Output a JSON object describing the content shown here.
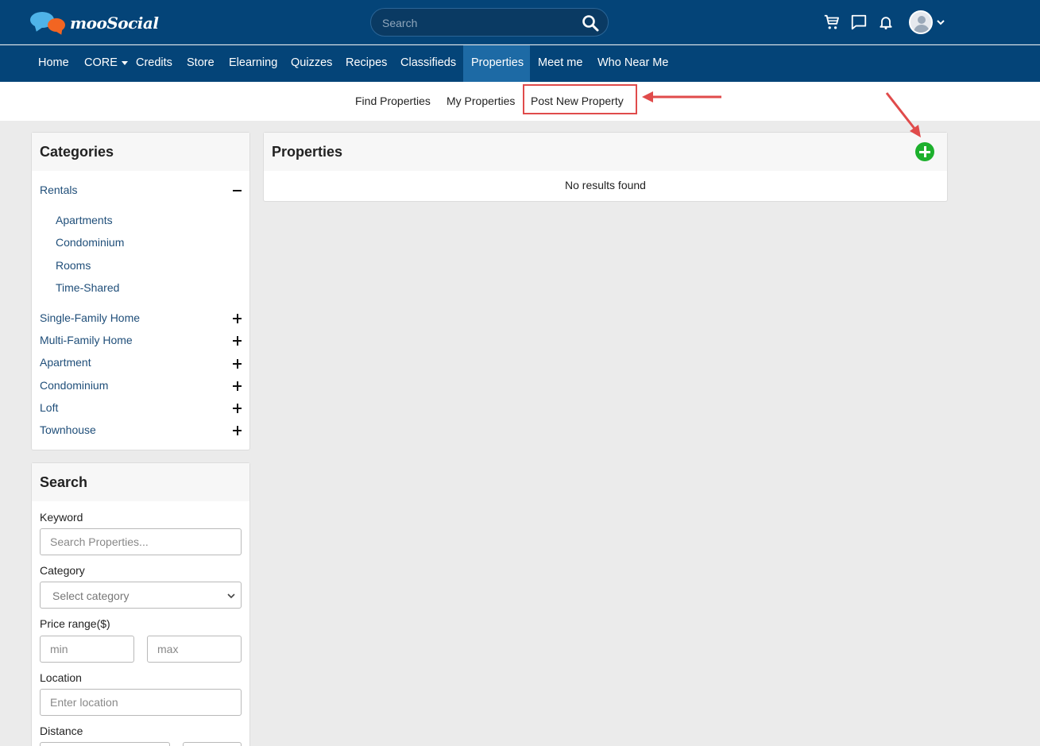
{
  "header": {
    "logo_text": "mooSocial",
    "search_placeholder": "Search"
  },
  "icons": [
    "cart-icon",
    "chat-icon",
    "bell-icon",
    "avatar",
    "chevron-down-icon",
    "search-icon",
    "add-icon"
  ],
  "colors": {
    "header_bg": "#044478",
    "active_nav": "#1d6aa5",
    "link": "#1f4e79",
    "add_button": "#1db02d",
    "annotation": "#e04b4b"
  },
  "nav": {
    "items": [
      "Home",
      "CORE",
      "Credits",
      "Store",
      "Elearning",
      "Quizzes",
      "Recipes",
      "Classifieds",
      "Properties",
      "Meet me",
      "Who Near Me"
    ],
    "active": "Properties"
  },
  "subnav": {
    "find": "Find Properties",
    "mine": "My Properties",
    "post": "Post New Property"
  },
  "categories": {
    "title": "Categories",
    "rentals": "Rentals",
    "rental_subs": [
      "Apartments",
      "Condominium",
      "Rooms",
      "Time-Shared"
    ],
    "others": [
      "Single-Family Home",
      "Multi-Family Home",
      "Apartment",
      "Condominium",
      "Loft",
      "Townhouse"
    ]
  },
  "search": {
    "title": "Search",
    "keyword_label": "Keyword",
    "keyword_placeholder": "Search Properties...",
    "category_label": "Category",
    "category_placeholder": "Select category",
    "price_label": "Price range($)",
    "min_placeholder": "min",
    "max_placeholder": "max",
    "location_label": "Location",
    "location_placeholder": "Enter location",
    "distance_label": "Distance"
  },
  "properties": {
    "title": "Properties",
    "empty": "No results found"
  }
}
